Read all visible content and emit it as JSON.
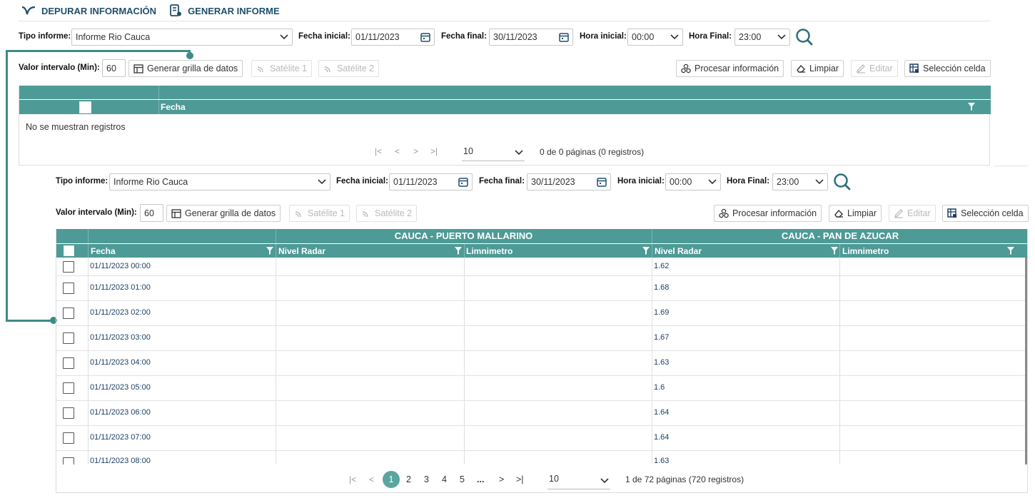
{
  "tabs": [
    {
      "label": "DEPURAR INFORMACIÓN",
      "icon": "validation-check-icon"
    },
    {
      "label": "GENERAR INFORME",
      "icon": "report-document-icon"
    }
  ],
  "filters": {
    "tipo_label": "Tipo informe:",
    "tipo_value": "Informe Rio Cauca",
    "fecha_inicial_label": "Fecha inicial:",
    "fecha_inicial_value": "01/11/2023",
    "fecha_final_label": "Fecha final:",
    "fecha_final_value": "30/11/2023",
    "hora_inicial_label": "Hora inicial:",
    "hora_inicial_value": "00:00",
    "hora_final_label": "Hora Final:",
    "hora_final_value": "23:00"
  },
  "toolbar": {
    "intervalo_label": "Valor intervalo (Min):",
    "intervalo_value": "60",
    "generar": "Generar grilla de datos",
    "satelite1": "Satélite 1",
    "satelite2": "Satélite 2",
    "procesar": "Procesar información",
    "limpiar": "Limpiar",
    "editar": "Editar",
    "seleccion": "Selección celda"
  },
  "empty_grid": {
    "col_fecha": "Fecha",
    "empty_message": "No se muestran registros",
    "page_size": "10",
    "pager_info": "0 de 0 páginas (0 registros)"
  },
  "grid": {
    "groups": [
      "CAUCA - PUERTO MALLARINO",
      "CAUCA - PAN DE AZUCAR"
    ],
    "columns": [
      "Fecha",
      "Nivel Radar",
      "Limnimetro",
      "Nivel Radar",
      "Limnimetro"
    ],
    "rows": [
      {
        "fecha": "01/11/2023 00:00",
        "pm_radar": "",
        "pm_limn": "",
        "pa_radar": "1.62",
        "pa_limn": ""
      },
      {
        "fecha": "01/11/2023 01:00",
        "pm_radar": "",
        "pm_limn": "",
        "pa_radar": "1.68",
        "pa_limn": ""
      },
      {
        "fecha": "01/11/2023 02:00",
        "pm_radar": "",
        "pm_limn": "",
        "pa_radar": "1.69",
        "pa_limn": ""
      },
      {
        "fecha": "01/11/2023 03:00",
        "pm_radar": "",
        "pm_limn": "",
        "pa_radar": "1.67",
        "pa_limn": ""
      },
      {
        "fecha": "01/11/2023 04:00",
        "pm_radar": "",
        "pm_limn": "",
        "pa_radar": "1.63",
        "pa_limn": ""
      },
      {
        "fecha": "01/11/2023 05:00",
        "pm_radar": "",
        "pm_limn": "",
        "pa_radar": "1.6",
        "pa_limn": ""
      },
      {
        "fecha": "01/11/2023 06:00",
        "pm_radar": "",
        "pm_limn": "",
        "pa_radar": "1.64",
        "pa_limn": ""
      },
      {
        "fecha": "01/11/2023 07:00",
        "pm_radar": "",
        "pm_limn": "",
        "pa_radar": "1.64",
        "pa_limn": ""
      },
      {
        "fecha": "01/11/2023 08:00",
        "pm_radar": "",
        "pm_limn": "",
        "pa_radar": "1.63",
        "pa_limn": ""
      }
    ],
    "pager": {
      "pages": [
        "1",
        "2",
        "3",
        "4",
        "5",
        "..."
      ],
      "active_page": "1",
      "page_size": "10",
      "info": "1 de 72 páginas (720 registros)"
    }
  },
  "colors": {
    "header_teal": "#4e9a96",
    "connector": "#3e8a86",
    "accent_blue": "#2f6f7c"
  }
}
